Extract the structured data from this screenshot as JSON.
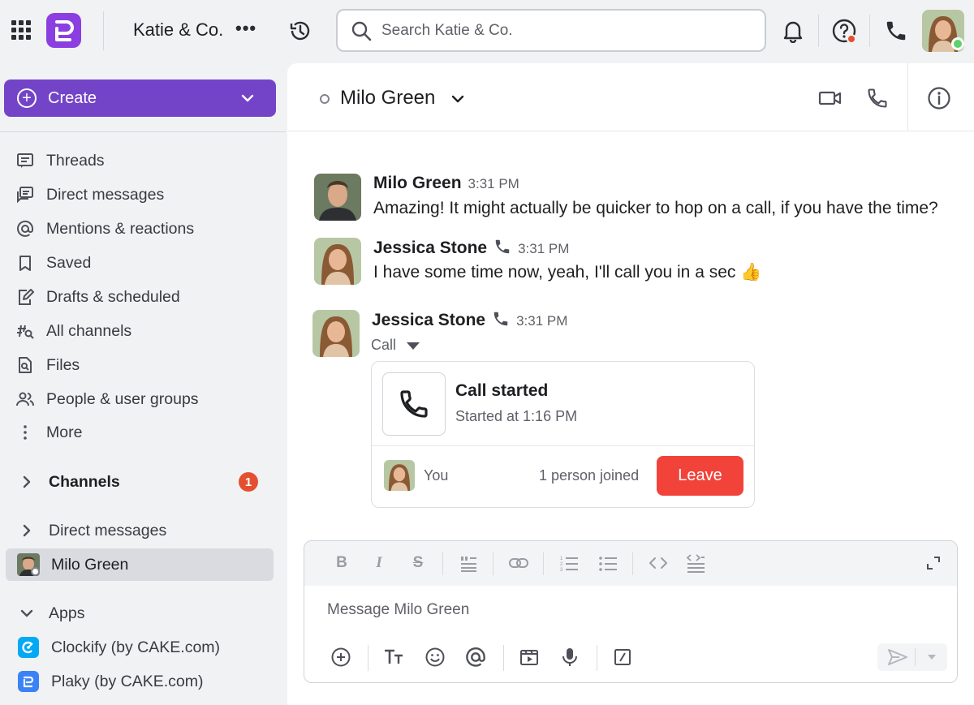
{
  "topbar": {
    "workspace_name": "Katie & Co.",
    "more_label": "•••",
    "search_placeholder": "Search Katie & Co."
  },
  "sidebar": {
    "create_label": "Create",
    "nav": [
      {
        "label": "Threads",
        "icon": "threads-icon"
      },
      {
        "label": "Direct messages",
        "icon": "direct-messages-icon"
      },
      {
        "label": "Mentions & reactions",
        "icon": "at-icon"
      },
      {
        "label": "Saved",
        "icon": "bookmark-icon"
      },
      {
        "label": "Drafts & scheduled",
        "icon": "draft-icon"
      },
      {
        "label": "All channels",
        "icon": "channel-search-icon"
      },
      {
        "label": "Files",
        "icon": "file-search-icon"
      },
      {
        "label": "People & user groups",
        "icon": "people-icon"
      },
      {
        "label": "More",
        "icon": "vertical-dots-icon"
      }
    ],
    "channels_label": "Channels",
    "channels_badge": "1",
    "dm_section_label": "Direct messages",
    "dm_active": "Milo Green",
    "apps_label": "Apps",
    "apps": [
      {
        "label": "Clockify (by CAKE.com)",
        "color": "#03a9f4"
      },
      {
        "label": "Plaky (by CAKE.com)",
        "color": "#3b82f6"
      }
    ]
  },
  "chat": {
    "title": "Milo Green",
    "messages": [
      {
        "author": "Milo Green",
        "time": "3:31 PM",
        "text": "Amazing! It might actually be quicker to hop on a call, if you have the time?"
      },
      {
        "author": "Jessica Stone",
        "time": "3:31 PM",
        "text": "I have some time now, yeah, I'll call you in a sec 👍"
      },
      {
        "author": "Jessica Stone",
        "time": "3:31 PM",
        "text": ""
      }
    ],
    "call": {
      "label": "Call",
      "title": "Call started",
      "subtitle": "Started at 1:16 PM",
      "you_label": "You",
      "joined": "1 person joined",
      "leave_label": "Leave"
    },
    "composer_placeholder": "Message Milo Green"
  },
  "colors": {
    "accent": "#7444c8",
    "leave": "#f2433a",
    "badge": "#e4502f",
    "online": "#5dd16a"
  }
}
